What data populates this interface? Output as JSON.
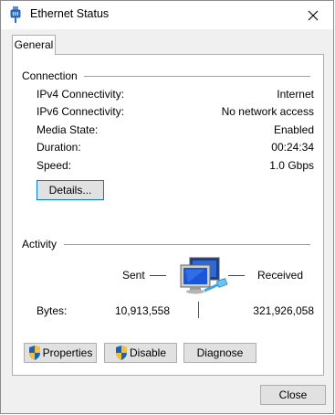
{
  "window": {
    "title": "Ethernet Status",
    "tab_general": "General"
  },
  "connection": {
    "header": "Connection",
    "rows": [
      {
        "label": "IPv4 Connectivity:",
        "value": "Internet"
      },
      {
        "label": "IPv6 Connectivity:",
        "value": "No network access"
      },
      {
        "label": "Media State:",
        "value": "Enabled"
      },
      {
        "label": "Duration:",
        "value": "00:24:34"
      },
      {
        "label": "Speed:",
        "value": "1.0 Gbps"
      }
    ],
    "details_button": "Details..."
  },
  "activity": {
    "header": "Activity",
    "sent_label": "Sent",
    "received_label": "Received",
    "bytes_label": "Bytes:",
    "bytes_sent": "10,913,558",
    "bytes_received": "321,926,058"
  },
  "buttons": {
    "properties": "Properties",
    "disable": "Disable",
    "diagnose": "Diagnose",
    "close": "Close"
  },
  "icons": {
    "title": "network-adapter-icon",
    "close": "close-icon",
    "activity": "network-computers-icon",
    "shield": "uac-shield-icon"
  },
  "colors": {
    "window_bg": "#f0f0f0",
    "panel_bg": "#ffffff",
    "focus_border": "#0078d7",
    "button_bg": "#e1e1e1",
    "shield_blue": "#1f5fb8",
    "shield_yellow": "#f2c230"
  }
}
